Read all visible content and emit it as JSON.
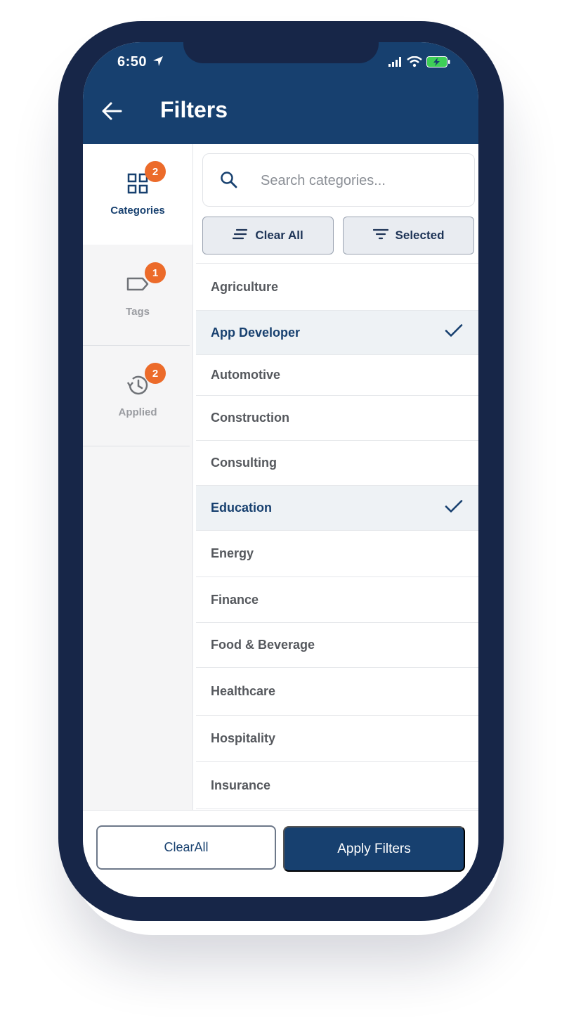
{
  "colors": {
    "primary": "#17406f",
    "badge": "#ec6b2a",
    "frame": "#172648"
  },
  "status_bar": {
    "time": "6:50"
  },
  "header": {
    "title": "Filters"
  },
  "sidebar": {
    "items": [
      {
        "label": "Categories",
        "badge": "2",
        "icon": "grid-icon",
        "active": true
      },
      {
        "label": "Tags",
        "badge": "1",
        "icon": "tag-icon",
        "active": false
      },
      {
        "label": "Applied",
        "badge": "2",
        "icon": "history-icon",
        "active": false
      }
    ]
  },
  "search": {
    "placeholder": "Search categories...",
    "value": ""
  },
  "chips": {
    "clear_all": "Clear All",
    "selected": "Selected"
  },
  "categories": [
    {
      "label": "Agriculture",
      "selected": false
    },
    {
      "label": "App Developer",
      "selected": true
    },
    {
      "label": "Automotive",
      "selected": false
    },
    {
      "label": "Construction",
      "selected": false
    },
    {
      "label": "Consulting",
      "selected": false
    },
    {
      "label": "Education",
      "selected": true
    },
    {
      "label": "Energy",
      "selected": false
    },
    {
      "label": "Finance",
      "selected": false
    },
    {
      "label": "Food & Beverage",
      "selected": false
    },
    {
      "label": "Healthcare",
      "selected": false
    },
    {
      "label": "Hospitality",
      "selected": false
    },
    {
      "label": "Insurance",
      "selected": false
    }
  ],
  "footer": {
    "clear_label": "ClearAll",
    "apply_label": "Apply Filters"
  }
}
